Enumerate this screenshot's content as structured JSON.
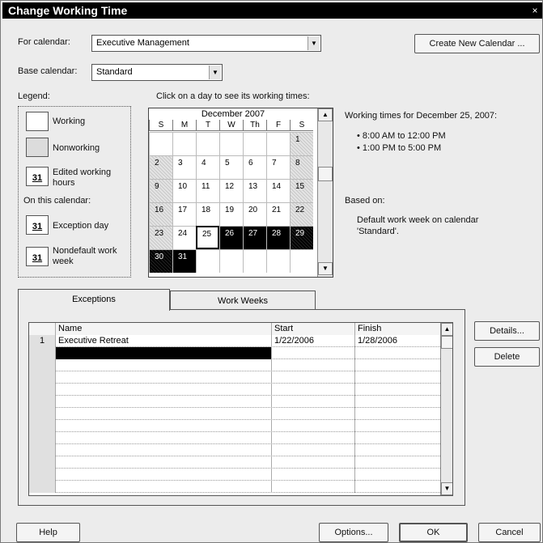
{
  "window": {
    "title": "Change Working Time",
    "close_glyph": "×"
  },
  "for_calendar": {
    "label": "For calendar:",
    "value": "Executive Management"
  },
  "base_calendar": {
    "label": "Base calendar:",
    "value": "Standard"
  },
  "create_new_calendar_label": "Create New Calendar ...",
  "legend": {
    "title": "Legend:",
    "working": "Working",
    "nonworking": "Nonworking",
    "edited_line1": "Edited working",
    "edited_line2": "hours",
    "on_this_calendar": "On this calendar:",
    "exception_day": "Exception day",
    "nondefault_line1": "Nondefault work",
    "nondefault_line2": "week",
    "day_number": "31"
  },
  "calendar": {
    "instruction": "Click on a day to see its working times:",
    "month_title": "December 2007",
    "weekdays": [
      "S",
      "M",
      "T",
      "W",
      "Th",
      "F",
      "S"
    ],
    "days": {
      "r0c6": "1",
      "r1c0": "2",
      "r1c1": "3",
      "r1c2": "4",
      "r1c3": "5",
      "r1c4": "6",
      "r1c5": "7",
      "r1c6": "8",
      "r2c0": "9",
      "r2c1": "10",
      "r2c2": "11",
      "r2c3": "12",
      "r2c4": "13",
      "r2c5": "14",
      "r2c6": "15",
      "r3c0": "16",
      "r3c1": "17",
      "r3c2": "18",
      "r3c3": "19",
      "r3c4": "20",
      "r3c5": "21",
      "r3c6": "22",
      "r4c0": "23",
      "r4c1": "24",
      "r4c2": "25",
      "r4c3": "26",
      "r4c4": "27",
      "r4c5": "28",
      "r4c6": "29",
      "r5c0": "30",
      "r5c1": "31"
    }
  },
  "working_times": {
    "heading": "Working times for December 25, 2007:",
    "time1": "• 8:00 AM to 12:00 PM",
    "time2": "• 1:00 PM to 5:00 PM",
    "based_on_label": "Based on:",
    "based_on_line1": "Default work week on calendar",
    "based_on_line2": "'Standard'."
  },
  "tabs": {
    "exceptions": "Exceptions",
    "work_weeks": "Work Weeks"
  },
  "exceptions_table": {
    "columns": {
      "name": "Name",
      "start": "Start",
      "finish": "Finish"
    },
    "rows": [
      {
        "num": "1",
        "name": "Executive Retreat",
        "start": "1/22/2006",
        "finish": "1/28/2006"
      }
    ]
  },
  "side_buttons": {
    "details": "Details...",
    "delete": "Delete"
  },
  "footer": {
    "help": "Help",
    "options": "Options...",
    "ok": "OK",
    "cancel": "Cancel"
  }
}
